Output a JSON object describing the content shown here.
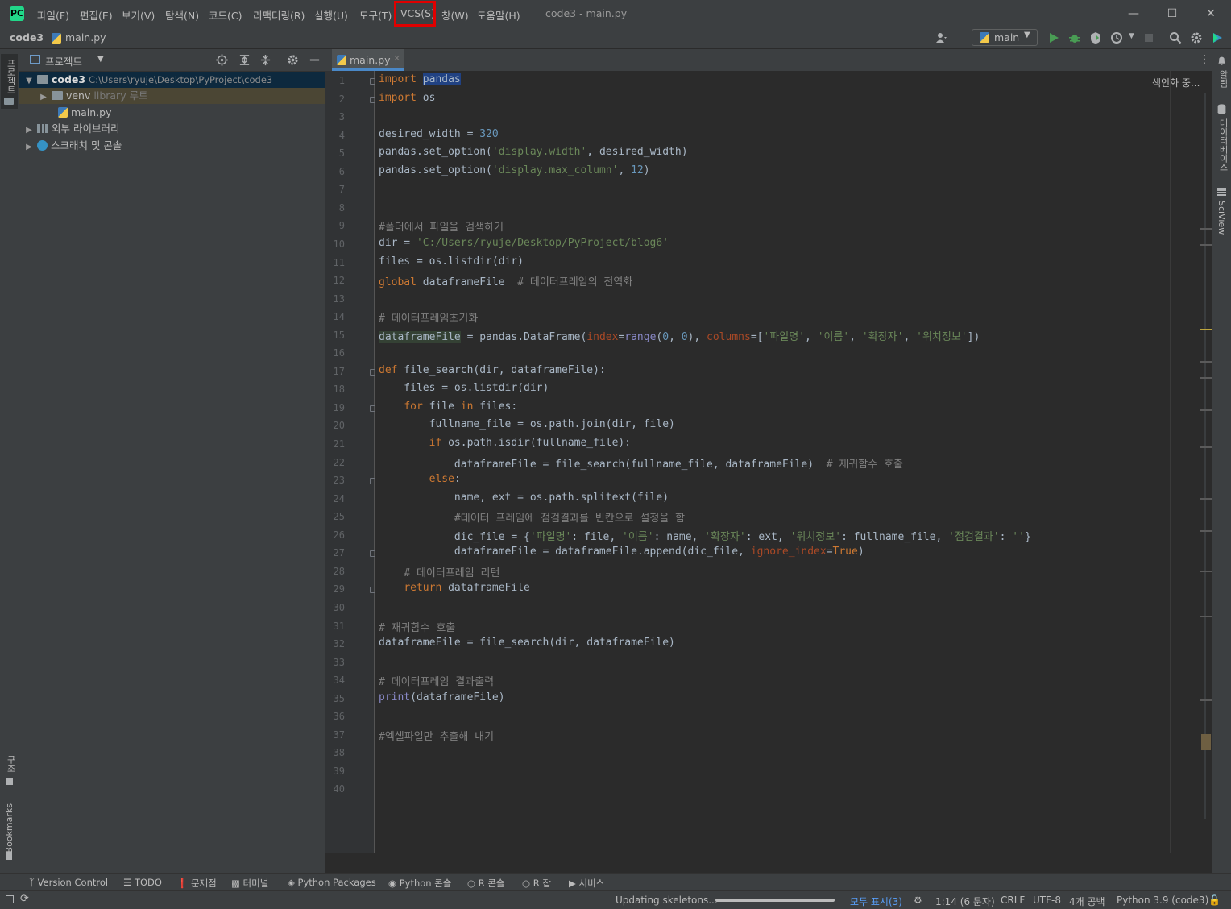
{
  "window": {
    "title": "code3 - main.py"
  },
  "menu": [
    "파일(F)",
    "편집(E)",
    "보기(V)",
    "탐색(N)",
    "코드(C)",
    "리팩터링(R)",
    "실행(U)",
    "도구(T)",
    "VCS(S)",
    "창(W)",
    "도움말(H)"
  ],
  "breadcrumb": {
    "project": "code3",
    "file": "main.py"
  },
  "toolbar": {
    "branch": "main"
  },
  "project_panel": {
    "title": "프로젝트",
    "root_name": "code3",
    "root_path": "C:\\Users\\ryuje\\Desktop\\PyProject\\code3",
    "venv": "venv",
    "venv_hint": "library 루트",
    "main_file": "main.py",
    "external": "외부 라이브러리",
    "scratch": "스크래치 및 콘솔"
  },
  "left_stripe": {
    "project": "프로젝트",
    "structure": "구조",
    "bookmarks": "Bookmarks"
  },
  "right_stripe": {
    "notifications": "알림",
    "database": "데이터베이스",
    "sciview": "SciView"
  },
  "tab": {
    "label": "main.py"
  },
  "editor": {
    "indexing": "색인화 중...",
    "line_numbers": [
      "1",
      "2",
      "3",
      "4",
      "5",
      "6",
      "7",
      "8",
      "9",
      "10",
      "11",
      "12",
      "13",
      "14",
      "15",
      "16",
      "17",
      "18",
      "19",
      "20",
      "21",
      "22",
      "23",
      "24",
      "25",
      "26",
      "27",
      "28",
      "29",
      "30",
      "31",
      "32",
      "33",
      "34",
      "35",
      "36",
      "37",
      "38",
      "39",
      "40"
    ],
    "lines": [
      "import pandas",
      "import os",
      "",
      "desired_width = 320",
      "pandas.set_option('display.width', desired_width)",
      "pandas.set_option('display.max_column', 12)",
      "",
      "",
      "#폴더에서 파일을 검색하기",
      "dir = 'C:/Users/ryuje/Desktop/PyProject/blog6'",
      "files = os.listdir(dir)",
      "global dataframeFile  # 데이터프레임의 전역화",
      "",
      "# 데이터프레임초기화",
      "dataframeFile = pandas.DataFrame(index=range(0, 0), columns=['파일명', '이름', '확장자', '위치정보'])",
      "",
      "def file_search(dir, dataframeFile):",
      "    files = os.listdir(dir)",
      "    for file in files:",
      "        fullname_file = os.path.join(dir, file)",
      "        if os.path.isdir(fullname_file):",
      "            dataframeFile = file_search(fullname_file, dataframeFile)  # 재귀함수 호출",
      "        else:",
      "            name, ext = os.path.splitext(file)",
      "            #데이터 프레임에 점검결과를 빈칸으로 설정을 함",
      "            dic_file = {'파일명': file, '이름': name, '확장자': ext, '위치정보': fullname_file, '점검결과': ''}",
      "            dataframeFile = dataframeFile.append(dic_file, ignore_index=True)",
      "    # 데이터프레임 리턴",
      "    return dataframeFile",
      "",
      "# 재귀함수 호출",
      "dataframeFile = file_search(dir, dataframeFile)",
      "",
      "# 데이터프레임 결과출력",
      "print(dataframeFile)",
      "",
      "#엑셀파일만 추출해 내기",
      "",
      "",
      ""
    ]
  },
  "bottom_tools": [
    "Version Control",
    "TODO",
    "문제점",
    "터미널",
    "Python Packages",
    "Python 콘솔",
    "R 콘솔",
    "R 잡",
    "서비스"
  ],
  "status": {
    "task": "Updating skeletons...",
    "show_all": "모두 표시(3)",
    "position": "1:14 (6 문자)",
    "line_sep": "CRLF",
    "encoding": "UTF-8",
    "indent": "4개 공백",
    "interpreter": "Python 3.9 (code3)"
  },
  "colors": {
    "highlight_box": "#e00000",
    "keyword": "#cc7832",
    "string": "#6a8759",
    "number": "#6897bb",
    "comment": "#808080"
  }
}
